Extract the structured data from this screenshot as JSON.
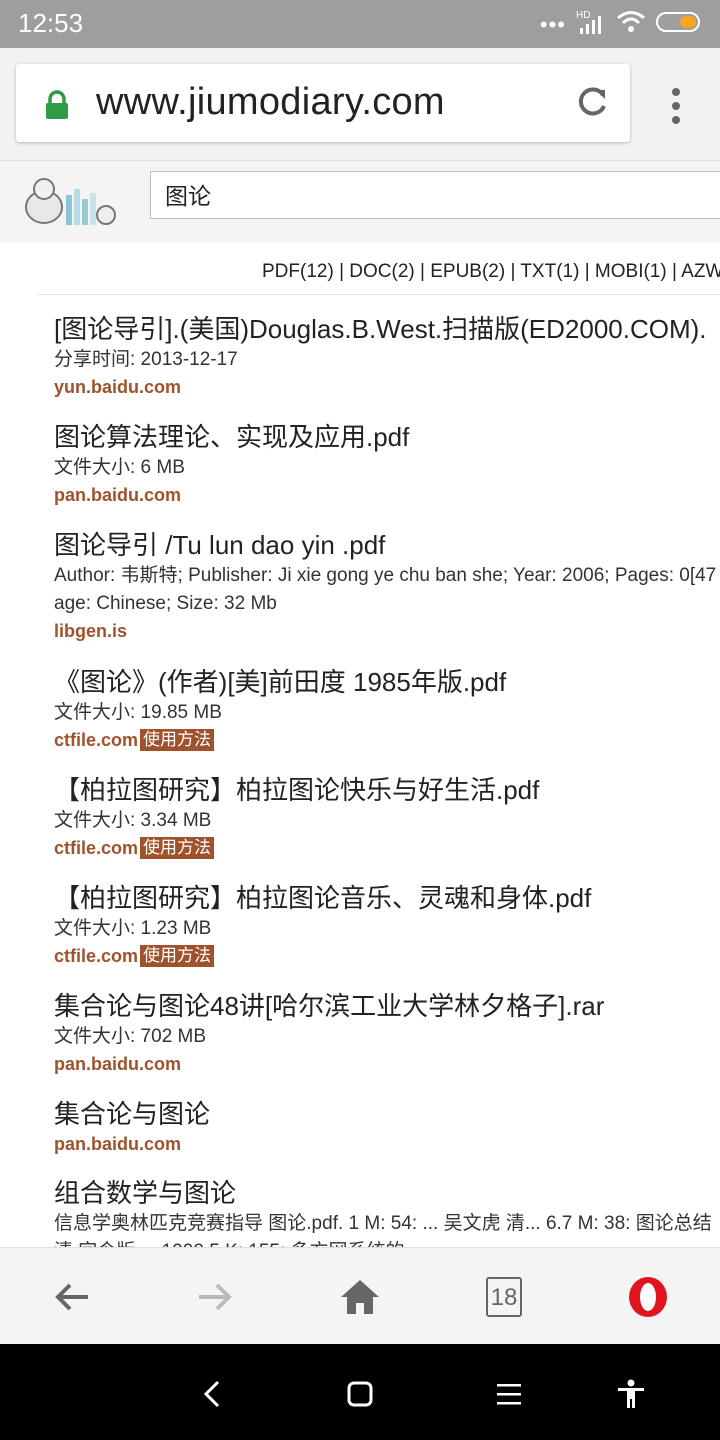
{
  "status": {
    "time": "12:53",
    "network": "HD"
  },
  "browser": {
    "url": "www.jiumodiary.com"
  },
  "search": {
    "query": "图论"
  },
  "filters": "PDF(12) | DOC(2) | EPUB(2) | TXT(1) | MOBI(1) | AZW(",
  "results": [
    {
      "title": "[图论导引].(美国)Douglas.B.West.扫描版(ED2000.COM).",
      "meta": "分享时间: 2013-12-17",
      "source": "yun.baidu.com"
    },
    {
      "title": "图论算法理论、实现及应用.pdf",
      "meta": "文件大小: 6 MB",
      "source": "pan.baidu.com"
    },
    {
      "title": "图论导引 /Tu lun dao yin .pdf",
      "meta": "Author: 韦斯特; Publisher: Ji xie gong ye chu ban she; Year: 2006; Pages: 0[47",
      "meta2": "age: Chinese; Size: 32 Mb",
      "source": "libgen.is"
    },
    {
      "title": "《图论》(作者)[美]前田度 1985年版.pdf",
      "meta": "文件大小: 19.85 MB",
      "source": "ctfile.com",
      "badge": "使用方法"
    },
    {
      "title": "【柏拉图研究】柏拉图论快乐与好生活.pdf",
      "meta": "文件大小: 3.34 MB",
      "source": "ctfile.com",
      "badge": "使用方法"
    },
    {
      "title": "【柏拉图研究】柏拉图论音乐、灵魂和身体.pdf",
      "meta": "文件大小: 1.23 MB",
      "source": "ctfile.com",
      "badge": "使用方法"
    },
    {
      "title": "集合论与图论48讲[哈尔滨工业大学林夕格子].rar",
      "meta": "文件大小: 702 MB",
      "source": "pan.baidu.com"
    },
    {
      "title": "集合论与图论",
      "source": "pan.baidu.com"
    },
    {
      "title": "组合数学与图论",
      "meta": "信息学奥林匹克竞赛指导 图论.pdf. 1 M: 54: ... 吴文虎 清... 6.7 M: 38: 图论总结",
      "meta2": "清 字令版 ... 1992 5 K: 155: 多方网系统的"
    }
  ],
  "bottom_nav": {
    "tabs_count": "18"
  },
  "colors": {
    "source": "#a0522d",
    "lock": "#2e9b45",
    "opera": "#e0141e"
  }
}
